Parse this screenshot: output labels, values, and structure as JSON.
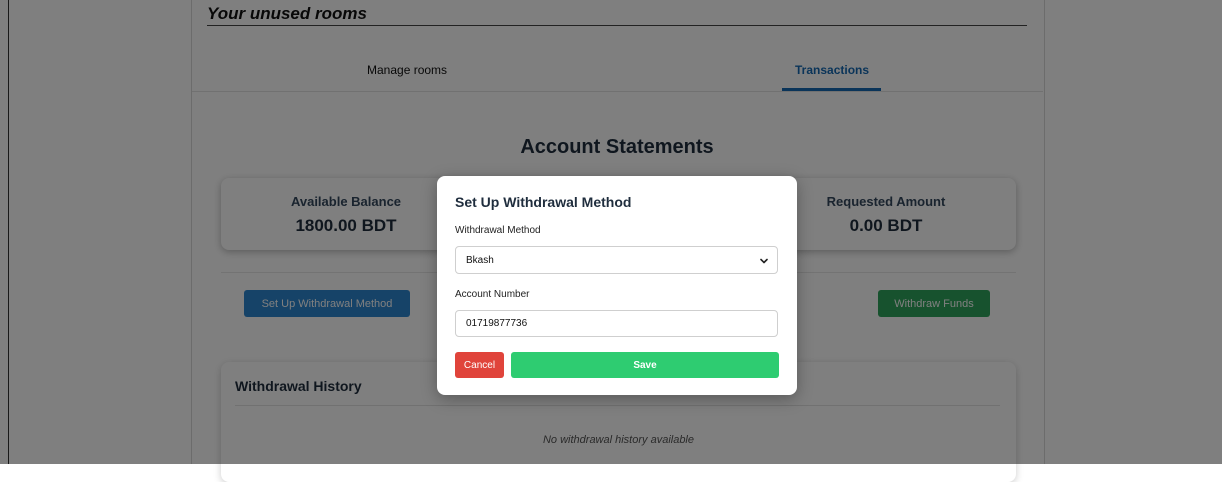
{
  "header": {
    "title": "Your unused rooms"
  },
  "tabs": [
    {
      "label": "Manage rooms",
      "active": false
    },
    {
      "label": "Transactions",
      "active": true
    }
  ],
  "section": {
    "title": "Account Statements"
  },
  "stats": {
    "available_label": "Available Balance",
    "available_value": "1800.00 BDT",
    "requested_label": "Requested Amount",
    "requested_value": "0.00 BDT"
  },
  "actions": {
    "setup_label": "Set Up Withdrawal Method",
    "withdraw_label": "Withdraw Funds"
  },
  "history": {
    "title": "Withdrawal History",
    "empty_text": "No withdrawal history available"
  },
  "modal": {
    "title": "Set Up Withdrawal Method",
    "method_label": "Withdrawal Method",
    "method_value": "Bkash",
    "account_label": "Account Number",
    "account_value": "01719877736",
    "cancel_label": "Cancel",
    "save_label": "Save"
  },
  "colors": {
    "accent": "#1569b3",
    "primary_button": "#2d86d0",
    "withdraw_button": "#2ea55c",
    "cancel_button": "#e0443b",
    "save_button": "#2ecc71"
  },
  "icons": {
    "select_arrow": "chevron-down-icon"
  }
}
